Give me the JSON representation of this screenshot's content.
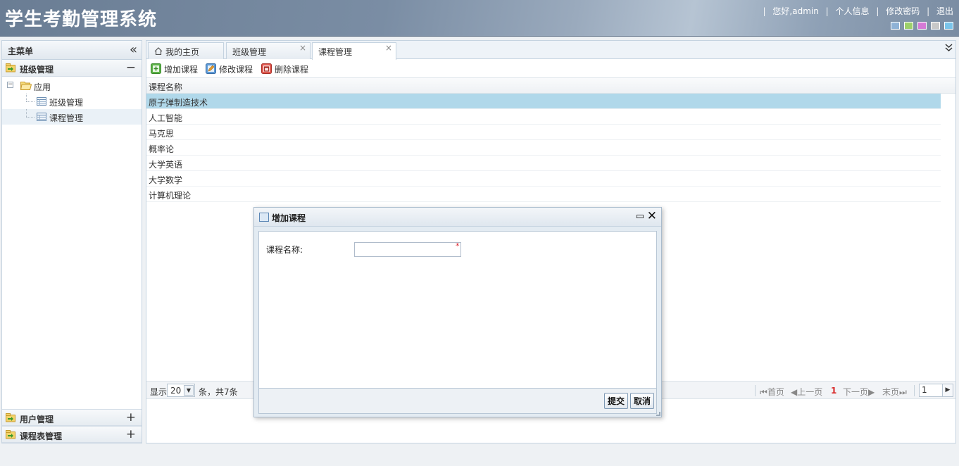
{
  "header": {
    "app_title": "学生考勤管理系统",
    "greeting": "您好,admin",
    "links": [
      "个人信息",
      "修改密码",
      "退出"
    ],
    "theme_colors": [
      "#8fb2d6",
      "#9ccf6a",
      "#d57ad6",
      "#c8c8c8",
      "#7ac4ea"
    ]
  },
  "sidebar": {
    "title": "主菜单",
    "panels": [
      {
        "label": "班级管理",
        "toggle": "−"
      },
      {
        "label": "用户管理",
        "toggle": "+"
      },
      {
        "label": "课程表管理",
        "toggle": "+"
      }
    ],
    "tree": {
      "root": "应用",
      "items": [
        "班级管理",
        "课程管理"
      ]
    }
  },
  "tabs": [
    {
      "label": "我的主页"
    },
    {
      "label": "班级管理",
      "close": "×"
    },
    {
      "label": "课程管理",
      "close": "×"
    }
  ],
  "toolbar": {
    "add": "增加课程",
    "edit": "修改课程",
    "delete": "删除课程"
  },
  "grid": {
    "column": "课程名称",
    "rows": [
      "原子弹制造技术",
      "人工智能",
      "马克思",
      "概率论",
      "大学英语",
      "大学数学",
      "计算机理论"
    ]
  },
  "pager": {
    "show_prefix": "显示",
    "page_size": "20",
    "count_text": "条，共7条",
    "first": "首页",
    "prev": "上一页",
    "current": "1",
    "next": "下一页",
    "last": "末页",
    "page_input": "1"
  },
  "dialog": {
    "title": "增加课程",
    "field_label": "课程名称:",
    "field_value": "",
    "required_mark": "*",
    "submit": "提交",
    "cancel": "取消"
  }
}
